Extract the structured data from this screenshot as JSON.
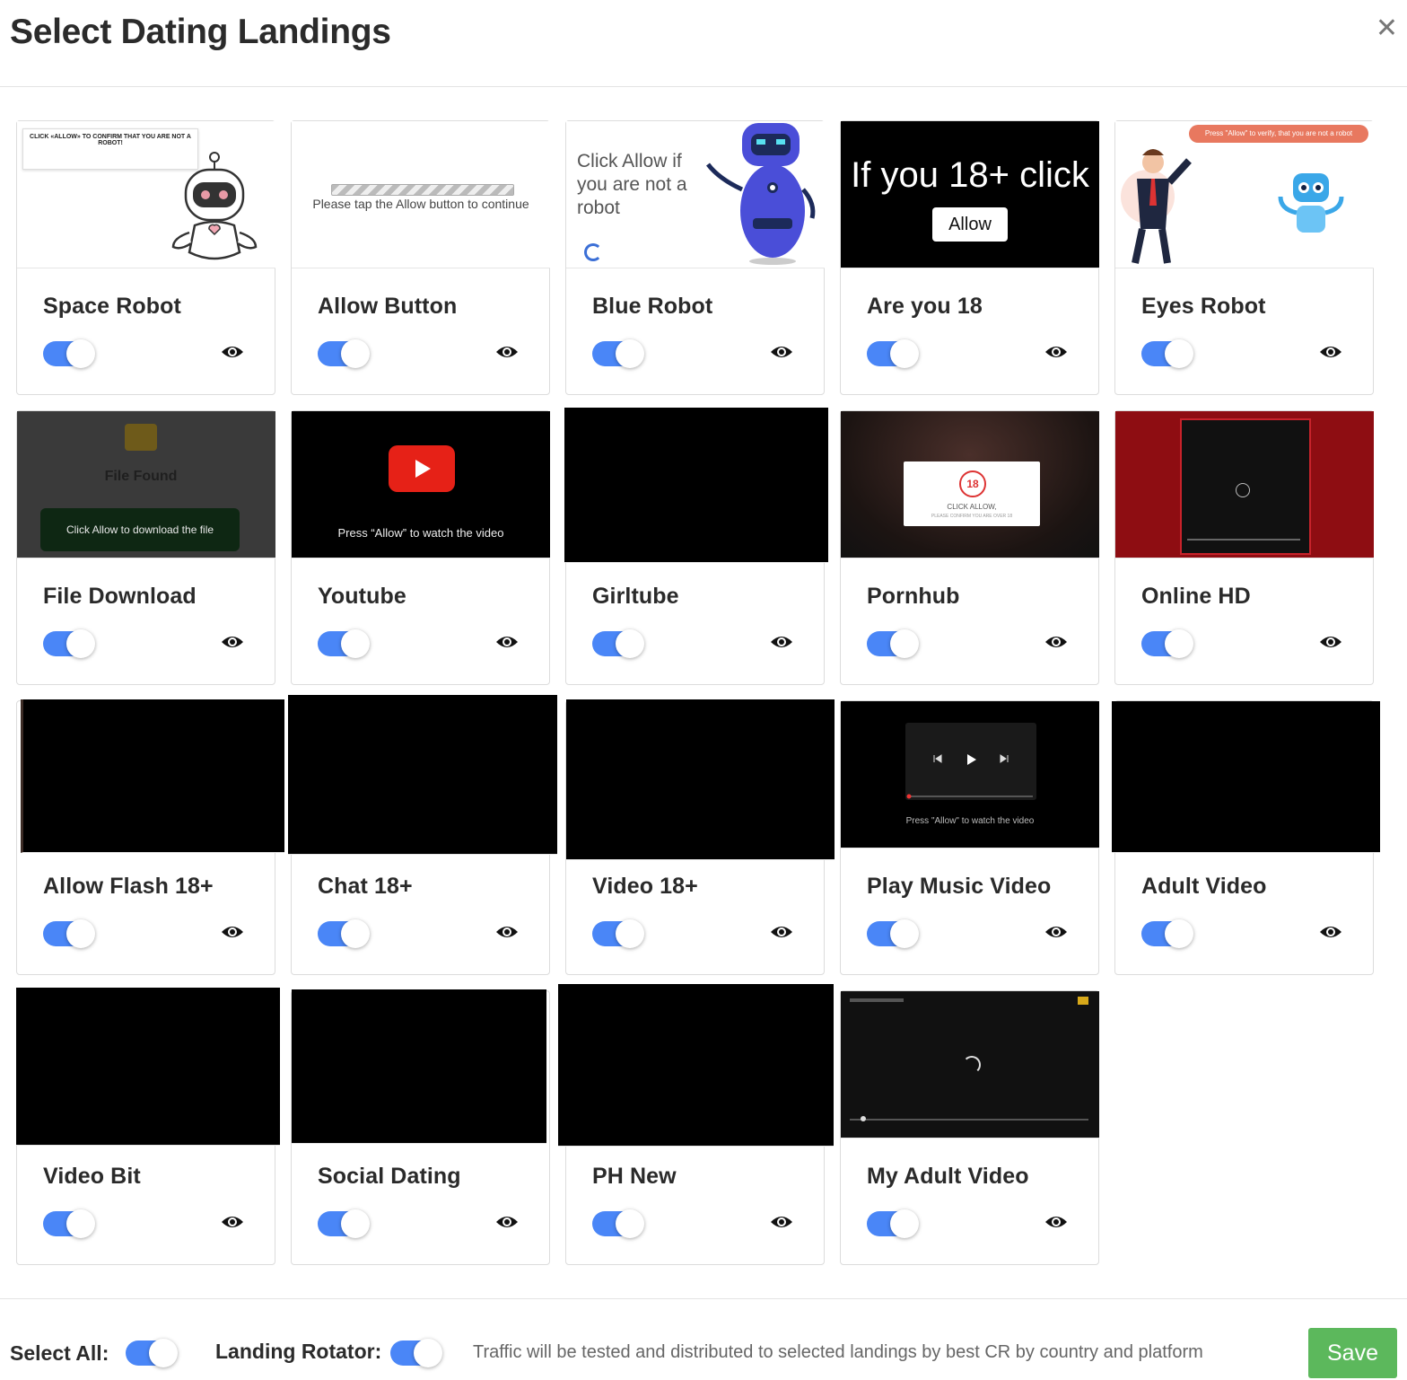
{
  "modal": {
    "title": "Select Dating Landings",
    "close_icon": "close-icon"
  },
  "colors": {
    "toggle_on": "#4a86f7",
    "save": "#5cb85c",
    "border": "#dcdcdc"
  },
  "previews": {
    "space_robot": "CLICK «ALLOW» TO CONFIRM THAT YOU ARE NOT A ROBOT!",
    "allow_button": "Please tap the Allow button to continue",
    "blue_robot": "Click Allow if you are not a robot",
    "are_you_18_heading": "If you 18+ click",
    "are_you_18_button": "Allow",
    "eyes_robot": "Press \"Allow\" to verify, that you are not a robot",
    "file_found": "File Found",
    "file_download_button": "Click Allow to download the file",
    "youtube": "Press “Allow” to watch the video",
    "pornhub_badge": "18",
    "pornhub_title": "CLICK ALLOW,",
    "pornhub_sub": "PLEASE CONFIRM YOU ARE OVER 18",
    "play_music": "Press \"Allow\" to watch the video"
  },
  "landings": [
    {
      "name": "Space Robot",
      "enabled": true
    },
    {
      "name": "Allow Button",
      "enabled": true
    },
    {
      "name": "Blue Robot",
      "enabled": true
    },
    {
      "name": "Are you 18",
      "enabled": true
    },
    {
      "name": "Eyes Robot",
      "enabled": true
    },
    {
      "name": "File Download",
      "enabled": true
    },
    {
      "name": "Youtube",
      "enabled": true
    },
    {
      "name": "Girltube",
      "enabled": true
    },
    {
      "name": "Pornhub",
      "enabled": true
    },
    {
      "name": "Online HD",
      "enabled": true
    },
    {
      "name": "Allow Flash 18+",
      "enabled": true
    },
    {
      "name": "Chat 18+",
      "enabled": true
    },
    {
      "name": "Video 18+",
      "enabled": true
    },
    {
      "name": "Play Music Video",
      "enabled": true
    },
    {
      "name": "Adult Video",
      "enabled": true
    },
    {
      "name": "Video Bit",
      "enabled": true
    },
    {
      "name": "Social Dating",
      "enabled": true
    },
    {
      "name": "PH New",
      "enabled": true
    },
    {
      "name": "My Adult Video",
      "enabled": true
    }
  ],
  "footer": {
    "select_all_label": "Select All:",
    "select_all_enabled": true,
    "rotator_label": "Landing Rotator:",
    "rotator_enabled": true,
    "note": "Traffic will be tested and distributed to selected landings by best CR by country and platform",
    "save_label": "Save"
  }
}
